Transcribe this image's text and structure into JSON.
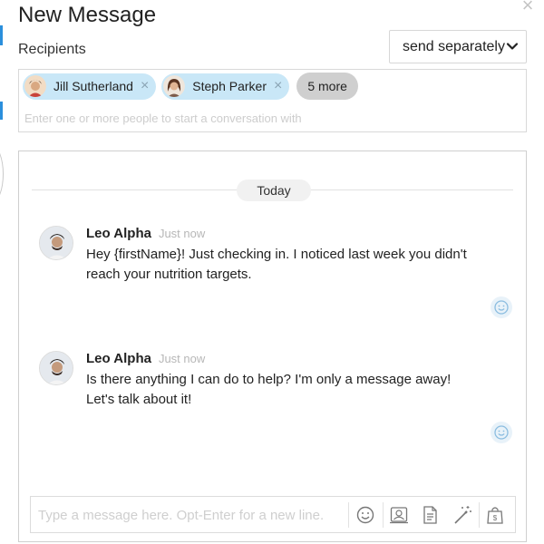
{
  "dialog": {
    "title": "New Message",
    "recipients_label": "Recipients",
    "send_mode": {
      "selected": "send separately"
    },
    "recipients": [
      {
        "name": "Jill Sutherland"
      },
      {
        "name": "Steph Parker"
      }
    ],
    "more_label": "5 more",
    "recipient_placeholder": "Enter one or more people to start a conversation with"
  },
  "conversation": {
    "day_label": "Today",
    "messages": [
      {
        "author": "Leo Alpha",
        "time": "Just now",
        "line1": "Hey {firstName}! Just checking in. I noticed last week you didn't",
        "line2": "reach your nutrition targets."
      },
      {
        "author": "Leo Alpha",
        "time": "Just now",
        "line1": "Is there anything I can do to help? I'm only a message away!",
        "line2": "Let's talk about it!"
      }
    ]
  },
  "composer": {
    "placeholder": "Type a message here. Opt-Enter for a new line."
  },
  "icons": {
    "close": "close-icon",
    "chevron": "chevron-down-icon",
    "remove": "remove-recipient-icon",
    "reaction": "smiley-icon",
    "emoji": "emoji-icon",
    "contact": "contact-card-icon",
    "document": "document-icon",
    "magic": "magic-wand-icon",
    "payment": "payment-bag-icon"
  },
  "colors": {
    "chip_bg": "#c9e7f7",
    "more_chip_bg": "#cfcfcf",
    "reaction_bg": "#e8f2f9",
    "accent": "#2b8fdc"
  }
}
